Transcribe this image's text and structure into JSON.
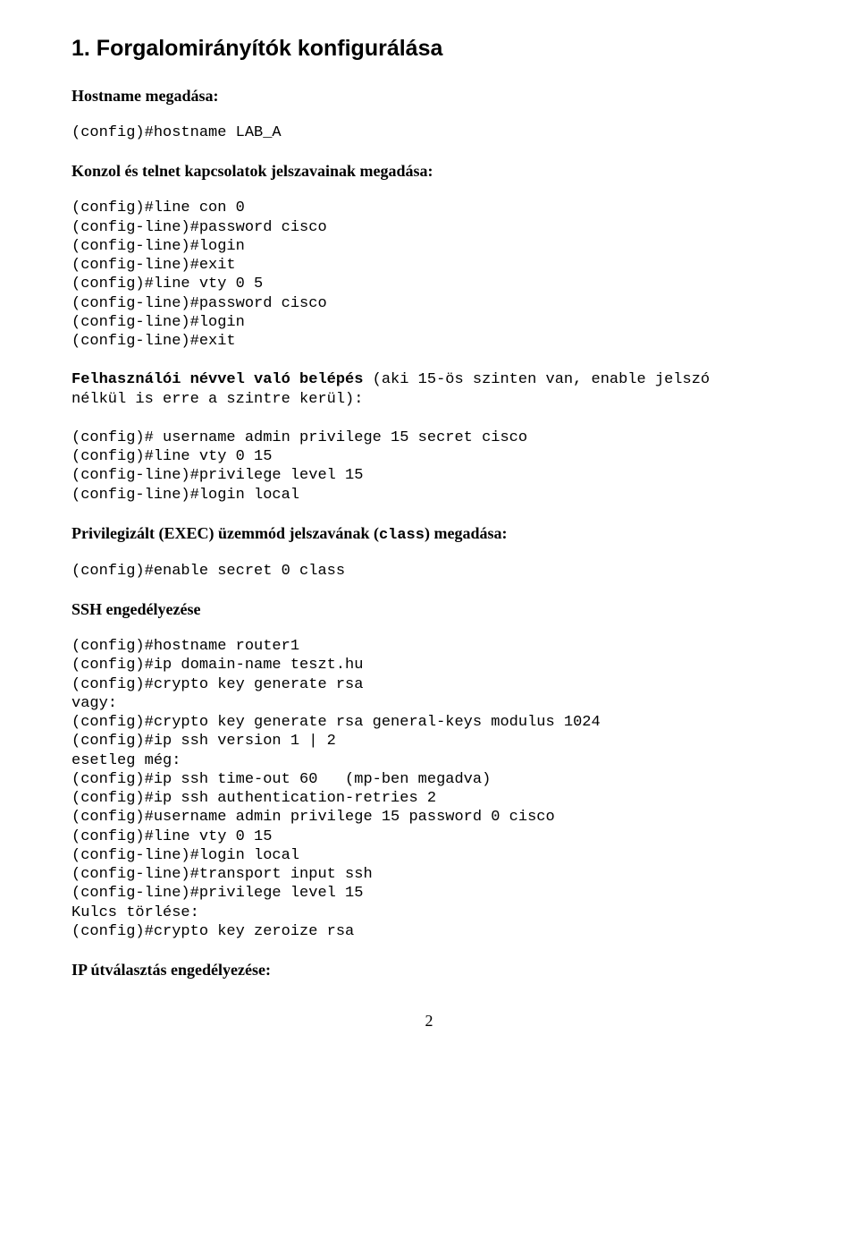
{
  "section1": {
    "title": "1. Forgalomirányítók konfigurálása",
    "hostname": {
      "label": "Hostname megadása:",
      "code": "(config)#hostname LAB_A"
    },
    "console_telnet": {
      "label": "Konzol és telnet kapcsolatok jelszavainak megadása:",
      "code": "(config)#line con 0\n(config-line)#password cisco\n(config-line)#login\n(config-line)#exit\n(config)#line vty 0 5\n(config-line)#password cisco\n(config-line)#login\n(config-line)#exit"
    },
    "user_login": {
      "label_bold": "Felhasználói névvel való belépés ",
      "label_rest": "(aki 15-ös szinten van, enable jelszó\nnélkül is erre a szintre kerül):",
      "code": "(config)# username admin privilege 15 secret cisco\n(config)#line vty 0 15\n(config-line)#privilege level 15\n(config-line)#login local"
    },
    "exec_password": {
      "label_prefix": "Privilegizált (EXEC) üzemmód jelszavának (",
      "label_mono": "class",
      "label_suffix": ") megadása:",
      "code": "(config)#enable secret 0 class"
    },
    "ssh": {
      "label": "SSH engedélyezése",
      "code": "(config)#hostname router1\n(config)#ip domain-name teszt.hu\n(config)#crypto key generate rsa\nvagy:\n(config)#crypto key generate rsa general-keys modulus 1024\n(config)#ip ssh version 1 | 2\nesetleg még:\n(config)#ip ssh time-out 60   (mp-ben megadva)\n(config)#ip ssh authentication-retries 2\n(config)#username admin privilege 15 password 0 cisco\n(config)#line vty 0 15\n(config-line)#login local\n(config-line)#transport input ssh\n(config-line)#privilege level 15\nKulcs törlése:\n(config)#crypto key zeroize rsa"
    },
    "ip_routing": {
      "label": "IP útválasztás engedélyezése:"
    }
  },
  "page_number": "2"
}
